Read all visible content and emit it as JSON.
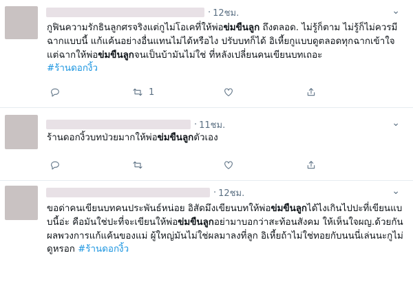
{
  "tweets": [
    {
      "time": "12ชม.",
      "text_parts": [
        "กูฟินความรักธินลูกศรจริงแต่กูไม่โอเคที่ให้พ่อ",
        "ข่มขืนลูก",
        " ถึงตลอด. ไม่รู้ก็ตาม ไม่รู้ก็ไม่ควรมีฉากแบบนี้ แก้แค้นอย่างอื่นแทนไม่ได้หรือไง ปรับบทก็ได้ อิเหี้ยกูแบบดูตลอดทุกฉากเข้าใจแต่ฉากให้พ่อ",
        "ข่มขืนลูก",
        "จนเป็นบ้ามันไม่ใช่ ที่หลังเปลี่ยนคนเขียนบทเถอะ"
      ],
      "hashtag": "#ร้านดอกงิ้ว",
      "retweets": "1"
    },
    {
      "time": "11ชม.",
      "text_parts": [
        "ร้านดอกงิ้วบทป่วยมากให้พ่อ",
        "ข่มขืนลูก",
        "ตัวเอง"
      ],
      "hashtag": "",
      "retweets": ""
    },
    {
      "time": "12ชม.",
      "text_parts": [
        "ขอด่าคนเขียนบทคนประพันธ์หน่อย อิสัดมึงเขียนบทให้พ่อ",
        "ข่มขืนลูก",
        "ได้ไงเกินไปปะที่เขียนแบบนี้อ่ะ คือมันใช่ปะที่จะเขียนให้พ่อ",
        "ข่มขืนลูก",
        "อย่ามาบอกว่าสะท้อนสังคม ให้เห็นใจผญ.ด้วยกัน ผลพวงการแก้แค้นของแม่ ผู้ใหญ่มันไม่ใช่ผลมาลงที่ลูก อิเหี้ยถ้าไม่ใช่ทอยกับนนนี่เล่นนะกูไม่ดูหรอก "
      ],
      "hashtag": "#ร้านดอกงิ้ว",
      "retweets": ""
    }
  ],
  "separator": "·",
  "more_icon": "more-dots-icon",
  "colors": {
    "hashtag": "#1b95e0",
    "muted": "#5b7083",
    "divider": "#e6ecf0"
  }
}
